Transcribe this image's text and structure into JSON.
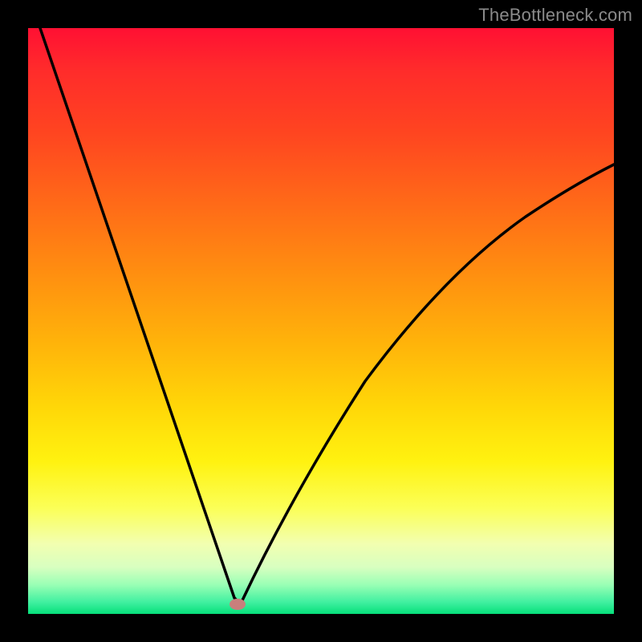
{
  "watermark": "TheBottleneck.com",
  "chart_data": {
    "type": "line",
    "title": "",
    "xlabel": "",
    "ylabel": "",
    "xlim": [
      0,
      100
    ],
    "ylim": [
      0,
      100
    ],
    "background_gradient": {
      "top": "#ff1033",
      "bottom": "#06df7a",
      "meaning": "red-high to green-low vertical gradient"
    },
    "series": [
      {
        "name": "bottleneck-curve",
        "x": [
          2,
          5,
          10,
          15,
          20,
          25,
          30,
          33,
          35,
          37,
          40,
          45,
          50,
          55,
          60,
          65,
          70,
          75,
          80,
          85,
          90,
          95,
          100
        ],
        "y": [
          100,
          92,
          80,
          68,
          55,
          41,
          24,
          8,
          0,
          5,
          17,
          34,
          47,
          57,
          64,
          69,
          73,
          76,
          79,
          81,
          83,
          85,
          86
        ]
      }
    ],
    "marker": {
      "name": "min-point",
      "x": 35,
      "y": 0,
      "color": "#d07a78"
    }
  }
}
